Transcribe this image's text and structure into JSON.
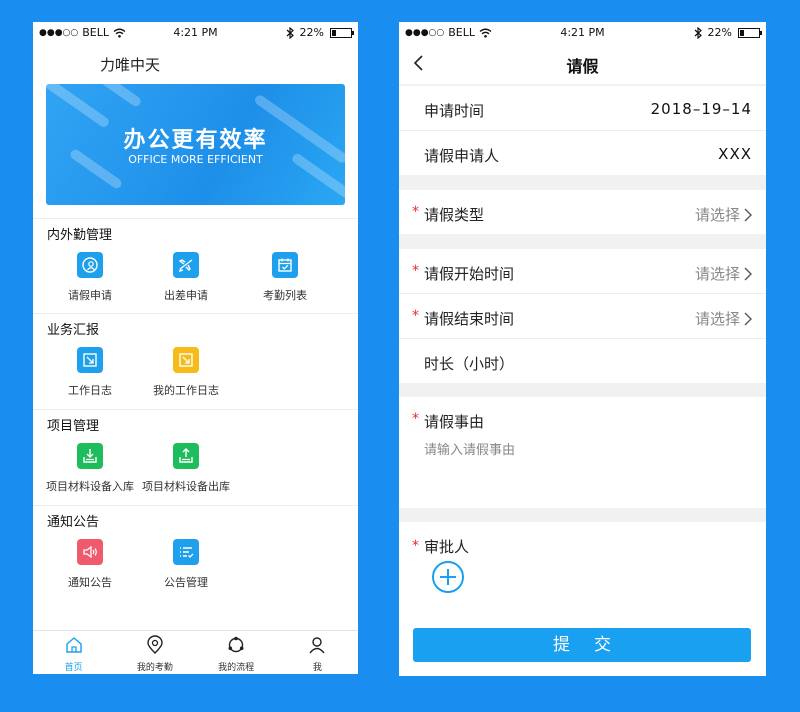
{
  "status_bar": {
    "carrier": "BELL",
    "time": "4:21 PM",
    "battery": "22%",
    "battery_level": 0.22
  },
  "home": {
    "app_title": "力唯中天",
    "banner": {
      "title": "办公更有效率",
      "subtitle": "OFFICE MORE EFFICIENT"
    },
    "sections": [
      {
        "title": "内外勤管理",
        "items": [
          {
            "label": "请假申请",
            "icon": "leave-icon",
            "color": "#1ea0ec"
          },
          {
            "label": "出差申请",
            "icon": "airplane-icon",
            "color": "#1ea0ec"
          },
          {
            "label": "考勤列表",
            "icon": "calendar-check-icon",
            "color": "#1ea0ec"
          }
        ]
      },
      {
        "title": "业务汇报",
        "items": [
          {
            "label": "工作日志",
            "icon": "edit-log-icon",
            "color": "#1ea0ec"
          },
          {
            "label": "我的工作日志",
            "icon": "edit-log-icon",
            "color": "#f6bb18"
          }
        ]
      },
      {
        "title": "项目管理",
        "items": [
          {
            "label": "项目材料设备入库",
            "icon": "inbound-icon",
            "color": "#1ebd5b"
          },
          {
            "label": "项目材料设备出库",
            "icon": "outbound-icon",
            "color": "#1ebd5b"
          }
        ]
      },
      {
        "title": "通知公告",
        "items": [
          {
            "label": "通知公告",
            "icon": "speaker-icon",
            "color": "#ef5a6c"
          },
          {
            "label": "公告管理",
            "icon": "list-check-icon",
            "color": "#1ea0ec"
          }
        ]
      }
    ],
    "tabbar": [
      {
        "label": "首页",
        "icon": "home-icon",
        "active": true
      },
      {
        "label": "我的考勤",
        "icon": "location-pin-icon",
        "active": false
      },
      {
        "label": "我的流程",
        "icon": "process-icon",
        "active": false
      },
      {
        "label": "我",
        "icon": "person-icon",
        "active": false
      }
    ]
  },
  "leave_form": {
    "title": "请假",
    "apply_time": {
      "label": "申请时间",
      "value": "2018–19–14"
    },
    "applicant": {
      "label": "请假申请人",
      "value": "XXX"
    },
    "leave_type": {
      "label": "请假类型",
      "placeholder": "请选择"
    },
    "start_time": {
      "label": "请假开始时间",
      "placeholder": "请选择"
    },
    "end_time": {
      "label": "请假结束时间",
      "placeholder": "请选择"
    },
    "duration": {
      "label": "时长（小时）"
    },
    "reason": {
      "label": "请假事由",
      "placeholder": "请输入请假事由"
    },
    "approver": {
      "label": "审批人"
    },
    "required_mark": "*",
    "submit_label": "提交"
  },
  "colors": {
    "accent": "#1aa0f0",
    "background": "#1a8ef0",
    "required": "#e52b2b"
  }
}
